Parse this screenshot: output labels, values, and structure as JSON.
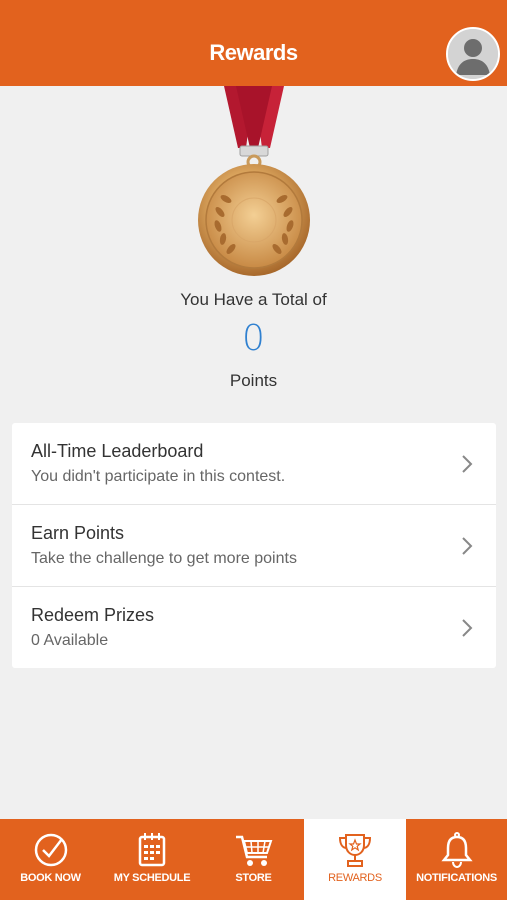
{
  "header": {
    "title": "Rewards",
    "avatar_icon": "user-avatar-icon"
  },
  "colors": {
    "brand": "#e2621e",
    "points": "#2f80d0",
    "background": "#f0f0f0"
  },
  "summary": {
    "total_label": "You Have a Total of",
    "points": "0",
    "points_label": "Points",
    "medal_icon": "medal-icon"
  },
  "menu": {
    "items": [
      {
        "title": "All-Time Leaderboard",
        "subtitle": "You didn't participate in this contest."
      },
      {
        "title": "Earn Points",
        "subtitle": "Take the challenge to get more points"
      },
      {
        "title": "Redeem Prizes",
        "subtitle": "0 Available"
      }
    ]
  },
  "tabs": [
    {
      "label": "BOOK NOW",
      "icon": "check-circle-icon"
    },
    {
      "label": "MY SCHEDULE",
      "icon": "calendar-icon"
    },
    {
      "label": "STORE",
      "icon": "cart-icon"
    },
    {
      "label": "REWARDS",
      "icon": "trophy-icon",
      "active": true
    },
    {
      "label": "NOTIFICATIONS",
      "icon": "bell-icon"
    }
  ]
}
